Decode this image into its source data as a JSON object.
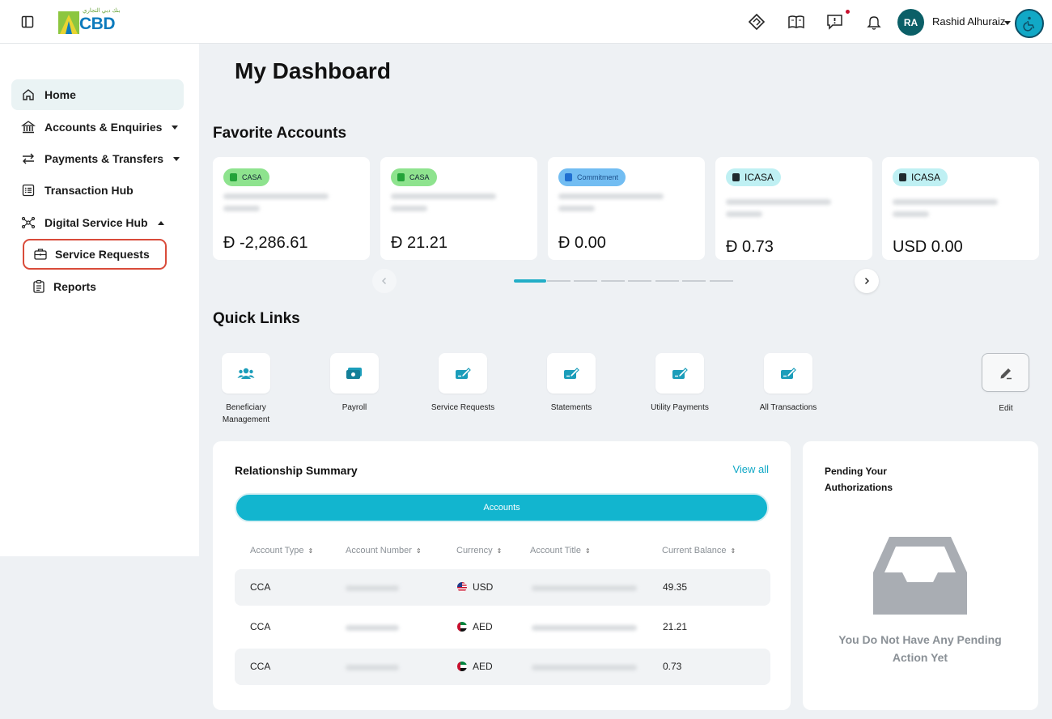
{
  "header": {
    "logo_text": "CBD",
    "logo_arabic": "بنك دبي التجاري",
    "user_initials": "RA",
    "user_name": "Rashid Alhuraiz"
  },
  "sidebar": {
    "items": [
      {
        "label": "Home",
        "icon": "home-icon"
      },
      {
        "label": "Accounts & Enquiries",
        "icon": "bank-icon"
      },
      {
        "label": "Payments & Transfers",
        "icon": "transfer-icon"
      },
      {
        "label": "Transaction Hub",
        "icon": "list-icon"
      },
      {
        "label": "Digital Service Hub",
        "icon": "network-icon"
      }
    ],
    "subitems": [
      {
        "label": "Service Requests",
        "icon": "briefcase-icon"
      },
      {
        "label": "Reports",
        "icon": "clipboard-icon"
      }
    ]
  },
  "main": {
    "title": "My Dashboard",
    "favorite_accounts_title": "Favorite Accounts",
    "quick_links_title": "Quick Links"
  },
  "accounts": [
    {
      "badge": "CASA",
      "balance": "Ð -2,286.61"
    },
    {
      "badge": "CASA",
      "balance": "Ð 21.21"
    },
    {
      "badge": "Commitment",
      "balance": "Ð 0.00"
    },
    {
      "badge": "ICASA",
      "balance": "Ð 0.73"
    },
    {
      "badge": "ICASA",
      "balance": "USD 0.00"
    }
  ],
  "quick_links": [
    {
      "label": "Beneficiary Management",
      "icon": "users-icon"
    },
    {
      "label": "Payroll",
      "icon": "payroll-icon"
    },
    {
      "label": "Service Requests",
      "icon": "edit-doc-icon"
    },
    {
      "label": "Statements",
      "icon": "edit-doc-icon"
    },
    {
      "label": "Utility Payments",
      "icon": "edit-doc-icon"
    },
    {
      "label": "All Transactions",
      "icon": "edit-doc-icon"
    },
    {
      "label": "Edit",
      "icon": "pencil-icon"
    }
  ],
  "relationship_summary": {
    "title": "Relationship Summary",
    "view_all": "View all",
    "tab": "Accounts",
    "columns": [
      "Account Type",
      "Account Number",
      "Currency",
      "Account Title",
      "Current Balance"
    ],
    "rows": [
      {
        "type": "CCA",
        "currency": "USD",
        "balance": "49.35"
      },
      {
        "type": "CCA",
        "currency": "AED",
        "balance": "21.21"
      },
      {
        "type": "CCA",
        "currency": "AED",
        "balance": "0.73"
      }
    ]
  },
  "pending": {
    "title_line1": "Pending Your",
    "title_line2": "Authorizations",
    "empty_line1": "You Do Not Have Any Pending",
    "empty_line2": "Action Yet"
  },
  "colors": {
    "accent": "#12b5cf",
    "brand_blue": "#0c7bbd",
    "highlight_border": "#d94b3a"
  }
}
